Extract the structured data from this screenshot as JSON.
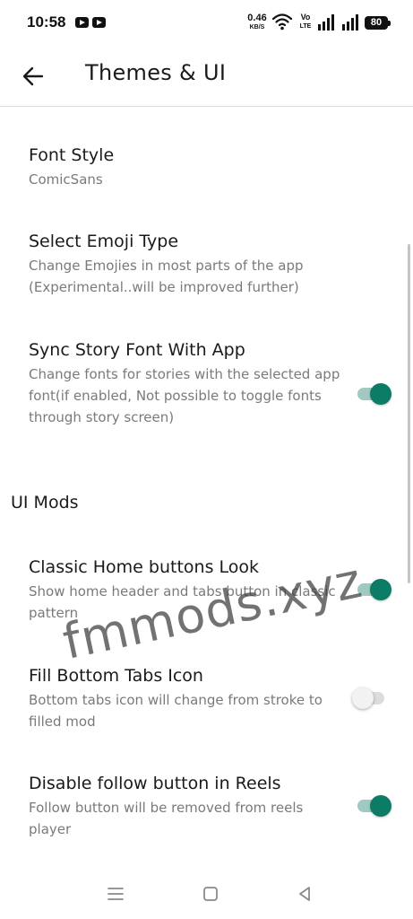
{
  "status_bar": {
    "time": "10:58",
    "net_speed_value": "0.46",
    "net_speed_unit": "KB/S",
    "volte_top": "Vo",
    "volte_bottom": "LTE",
    "battery": "80"
  },
  "app_bar": {
    "title": "Themes & UI"
  },
  "preferences": [
    {
      "title": "Font Style",
      "summary": "ComicSans"
    },
    {
      "title": "Select Emoji Type",
      "summary": "Change Emojies in most parts of the app (Experimental..will be improved further)"
    },
    {
      "title": "Sync Story Font With App",
      "summary": "Change fonts for stories with the selected app font(if enabled, Not possible to toggle fonts through story screen)",
      "switch_on": true
    }
  ],
  "section": {
    "title": "UI Mods"
  },
  "ui_mods": [
    {
      "title": "Classic Home buttons Look",
      "summary": "Show home header and tabs button in classic pattern",
      "switch_on": true
    },
    {
      "title": "Fill Bottom Tabs Icon",
      "summary": "Bottom tabs icon will change from stroke to filled mod",
      "switch_on": false
    },
    {
      "title": "Disable follow button in Reels",
      "summary": "Follow button will be removed from reels player",
      "switch_on": true
    }
  ],
  "watermark": "fmmods.xyz",
  "colors": {
    "accent": "#0d7c66",
    "accent_track": "#9fc9c1",
    "summary_text": "#7a7a7a"
  },
  "icons": {
    "back": "arrow-left-icon",
    "wifi": "wifi-icon",
    "signal": "signal-icon",
    "nav_menu": "menu-icon",
    "nav_home": "home-square-icon",
    "nav_back": "triangle-back-icon"
  }
}
